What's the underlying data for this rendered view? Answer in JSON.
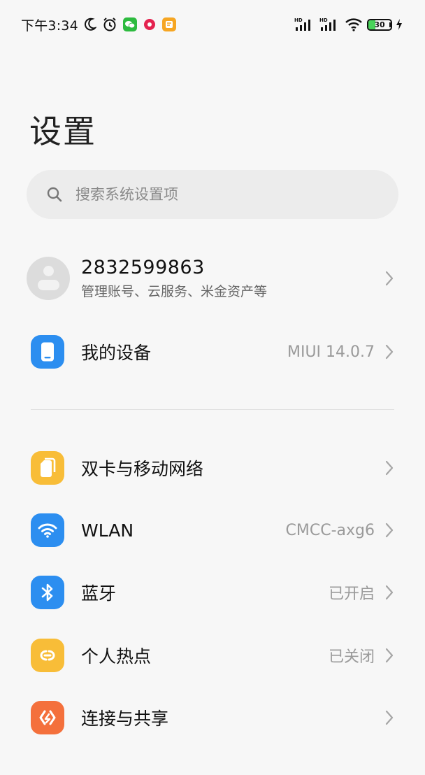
{
  "status_bar": {
    "time": "下午3:34",
    "battery_level": "30",
    "battery_fraction": 0.3,
    "left_icons": [
      "moon-icon",
      "alarm-icon",
      "wechat-icon",
      "app-red-icon",
      "app-yellow-icon"
    ],
    "right_icons": [
      "hd-signal-1-icon",
      "hd-signal-2-icon",
      "wifi-icon",
      "battery-icon",
      "charging-icon"
    ],
    "hd_label": "HD"
  },
  "page": {
    "title": "设置"
  },
  "search": {
    "placeholder": "搜索系统设置项",
    "value": ""
  },
  "account": {
    "id": "2832599863",
    "subtitle": "管理账号、云服务、米金资产等"
  },
  "rows": {
    "my_device": {
      "label": "我的设备",
      "value": "MIUI 14.0.7",
      "icon": "phone-icon",
      "color": "#2c8ef0"
    },
    "dual_sim": {
      "label": "双卡与移动网络",
      "value": "",
      "icon": "sim-card-icon",
      "color": "#f8bd38"
    },
    "wlan": {
      "label": "WLAN",
      "value": "CMCC-axg6",
      "icon": "wifi-icon",
      "color": "#2c8ef0"
    },
    "bluetooth": {
      "label": "蓝牙",
      "value": "已开启",
      "icon": "bluetooth-icon",
      "color": "#2c8ef0"
    },
    "hotspot": {
      "label": "个人热点",
      "value": "已关闭",
      "icon": "hotspot-icon",
      "color": "#f8bd38"
    },
    "connect_share": {
      "label": "连接与共享",
      "value": "",
      "icon": "connect-share-icon",
      "color": "#f4703c"
    }
  }
}
